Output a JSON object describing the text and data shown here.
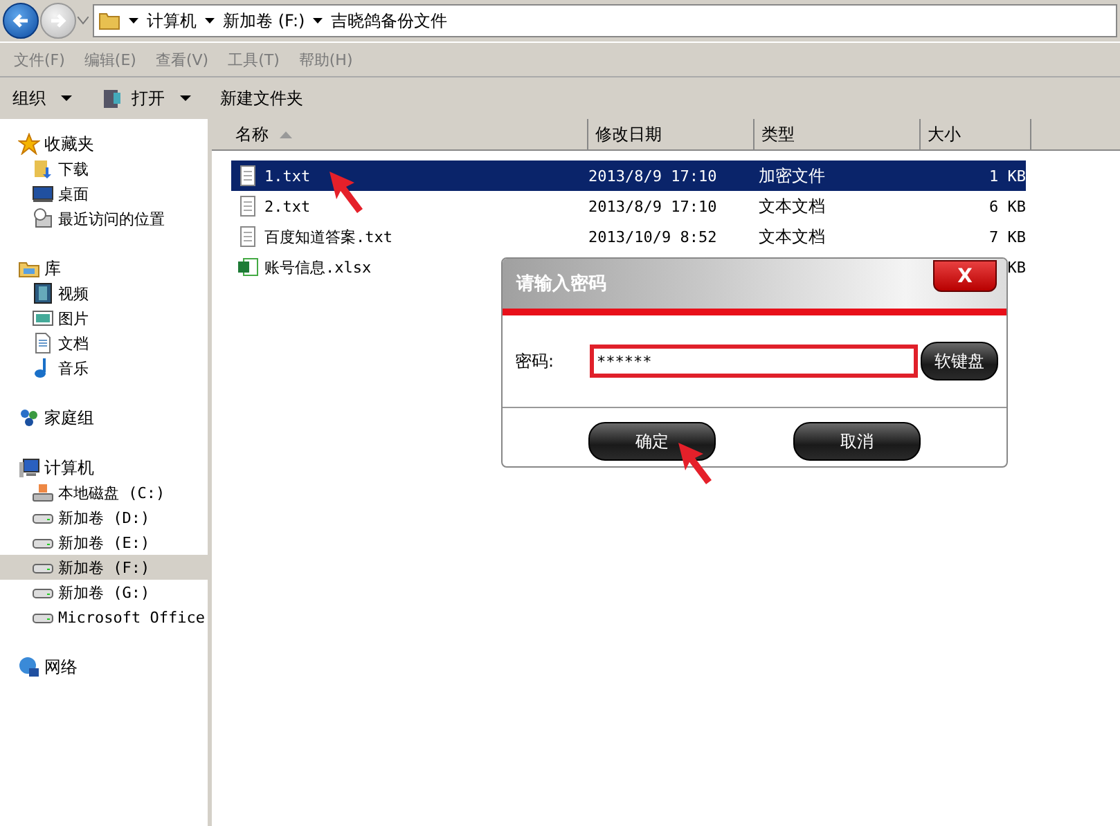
{
  "address": {
    "crumbs": [
      "计算机",
      "新加卷 (F:)",
      "吉晓鸽备份文件"
    ]
  },
  "menu": [
    "文件(F)",
    "编辑(E)",
    "查看(V)",
    "工具(T)",
    "帮助(H)"
  ],
  "toolbar": [
    {
      "label": "组织",
      "kind": "dropdown"
    },
    {
      "label": "打开",
      "kind": "open"
    },
    {
      "label": "新建文件夹",
      "kind": "plain"
    }
  ],
  "sidebar": [
    {
      "label": "收藏夹",
      "kind": "star",
      "children": [
        {
          "label": "下载",
          "kind": "download",
          "selected": false
        },
        {
          "label": "桌面",
          "kind": "desktop",
          "selected": false
        },
        {
          "label": "最近访问的位置",
          "kind": "recent",
          "selected": false
        }
      ]
    },
    {
      "label": "库",
      "kind": "library",
      "children": [
        {
          "label": "视频",
          "kind": "video",
          "selected": false
        },
        {
          "label": "图片",
          "kind": "image",
          "selected": false
        },
        {
          "label": "文档",
          "kind": "doc",
          "selected": false
        },
        {
          "label": "音乐",
          "kind": "music",
          "selected": false
        }
      ]
    },
    {
      "label": "家庭组",
      "kind": "homegroup"
    },
    {
      "label": "计算机",
      "kind": "computer",
      "children": [
        {
          "label": "本地磁盘 (C:)",
          "kind": "sysdrive",
          "selected": false
        },
        {
          "label": "新加卷 (D:)",
          "kind": "drive",
          "selected": false
        },
        {
          "label": "新加卷 (E:)",
          "kind": "drive",
          "selected": false
        },
        {
          "label": "新加卷 (F:)",
          "kind": "drive",
          "selected": true
        },
        {
          "label": "新加卷 (G:)",
          "kind": "drive",
          "selected": false
        },
        {
          "label": "Microsoft Office",
          "kind": "drive",
          "selected": false
        }
      ]
    },
    {
      "label": "网络",
      "kind": "network"
    }
  ],
  "table": {
    "columns": [
      "名称",
      "修改日期",
      "类型",
      "大小"
    ],
    "rows": [
      {
        "name": "1.txt",
        "kind": "txt",
        "date": "2013/8/9 17:10",
        "type": "加密文件",
        "size": "1 KB",
        "selected": true
      },
      {
        "name": "2.txt",
        "kind": "txt",
        "date": "2013/8/9 17:10",
        "type": "文本文档",
        "size": "6 KB",
        "selected": false
      },
      {
        "name": "百度知道答案.txt",
        "kind": "txt",
        "date": "2013/10/9 8:52",
        "type": "文本文档",
        "size": "7 KB",
        "selected": false
      },
      {
        "name": "账号信息.xlsx",
        "kind": "xlsx",
        "size": "KB",
        "selected": false
      }
    ]
  },
  "dialog": {
    "title": "请输入密码",
    "close": "X",
    "label": "密码:",
    "value": "******",
    "keyboard_button": "软键盘",
    "buttons": [
      "确定",
      "取消"
    ]
  }
}
